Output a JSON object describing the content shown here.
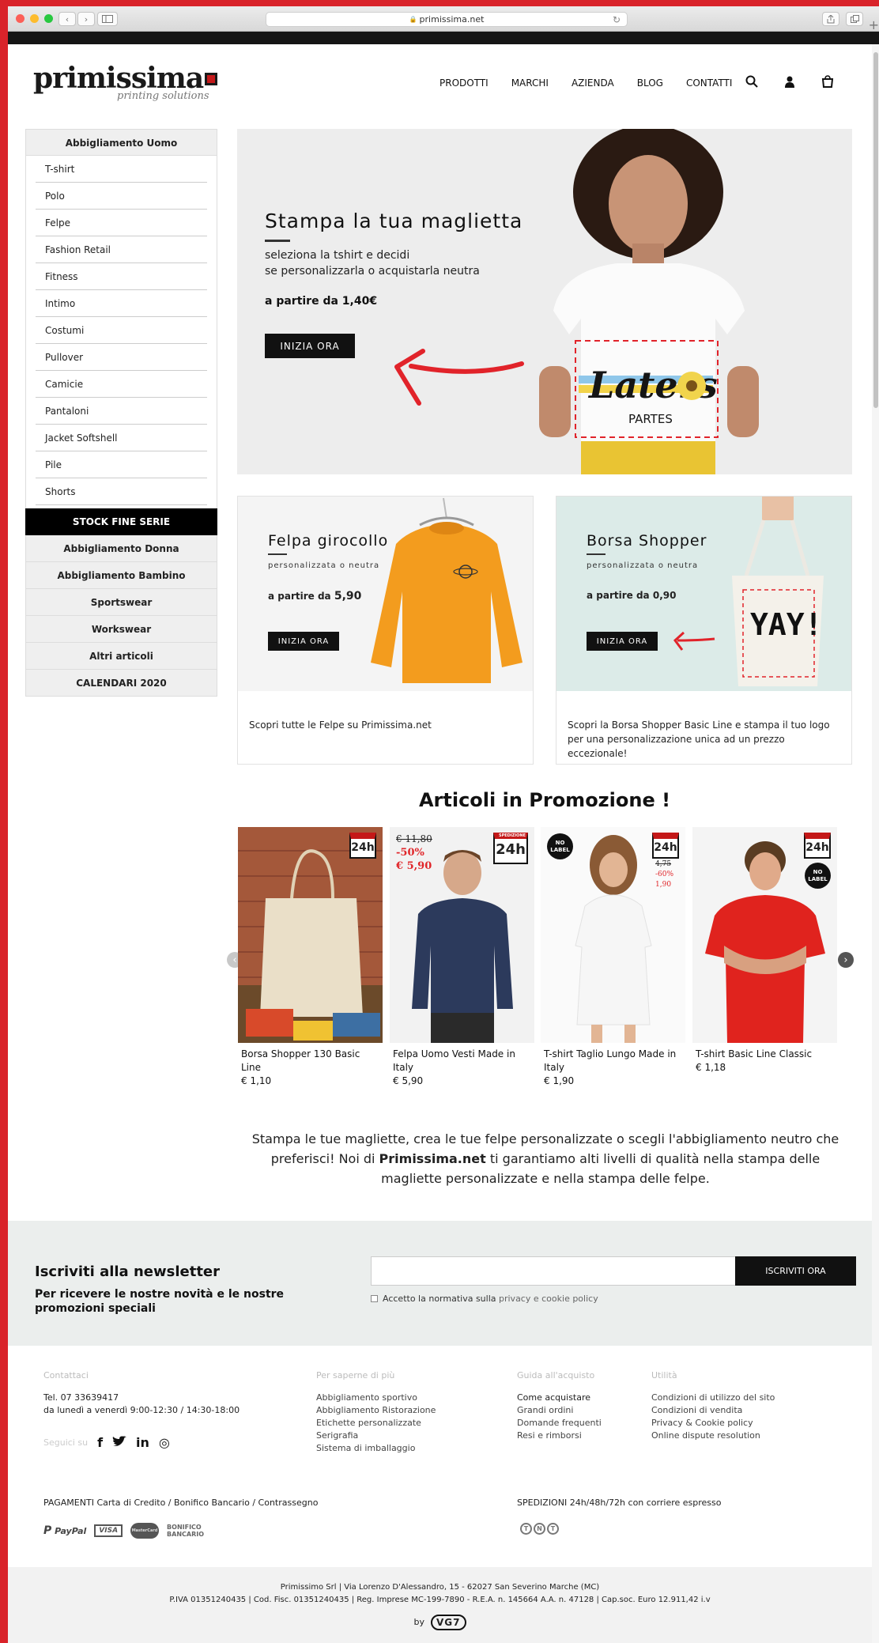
{
  "browser": {
    "url": "primissima.net",
    "lock_icon": "🔒",
    "back_icon": "‹",
    "forward_icon": "›",
    "reload_icon": "↻"
  },
  "header": {
    "logo_text": "primissima",
    "logo_sub": "printing solutions",
    "nav": [
      "PRODOTTI",
      "MARCHI",
      "AZIENDA",
      "BLOG",
      "CONTATTI"
    ]
  },
  "sidebar": {
    "heading": "Abbigliamento Uomo",
    "subitems": [
      "T-shirt",
      "Polo",
      "Felpe",
      "Fashion Retail",
      "Fitness",
      "Intimo",
      "Costumi",
      "Pullover",
      "Camicie",
      "Pantaloni",
      "Jacket Softshell",
      "Pile",
      "Shorts"
    ],
    "stock": "STOCK FINE SERIE",
    "categories": [
      "Abbigliamento Donna",
      "Abbigliamento Bambino",
      "Sportswear",
      "Workswear",
      "Altri articoli",
      "CALENDARI 2020"
    ]
  },
  "hero": {
    "title": "Stampa la tua maglietta",
    "sub1": "seleziona la tshirt e decidi",
    "sub2": "se personalizzarla o acquistarla neutra",
    "price": "a partire da 1,40€",
    "button": "INIZIA ORA",
    "shirt_text": "Laters",
    "shirt_sub": "PARTES"
  },
  "cards": [
    {
      "title": "Felpa girocollo",
      "sub": "personalizzata o neutra",
      "price_prefix": "a partire da ",
      "price": "5,90",
      "button": "INIZIA ORA",
      "desc": "Scopri tutte le Felpe su Primissima.net"
    },
    {
      "title": "Borsa Shopper",
      "sub": "personalizzata o neutra",
      "price_prefix": "a partire da ",
      "price": "0,90",
      "button": "INIZIA ORA",
      "desc": "Scopri la Borsa Shopper Basic Line e stampa il tuo logo per una personalizzazione unica ad un prezzo eccezionale!",
      "bag_text": "YAY!"
    }
  ],
  "promo": {
    "title": "Articoli in Promozione !",
    "badge": "24h",
    "badge_label": "SPEDIZIONE",
    "nolabel": "NO LABEL",
    "products": [
      {
        "name": "Borsa Shopper 130 Basic Line",
        "price": "€ 1,10"
      },
      {
        "name": "Felpa Uomo Vesti Made in Italy",
        "price": "€ 5,90",
        "old": "€ 11,80",
        "pct": "-50%",
        "new": "€ 5,90"
      },
      {
        "name": "T-shirt Taglio Lungo Made in Italy",
        "price": "€ 1,90",
        "old": "4,75",
        "pct": "-60%",
        "new": "1,90"
      },
      {
        "name": "T-shirt Basic Line Classic",
        "price": "€ 1,18"
      }
    ]
  },
  "intro": {
    "part1": "Stampa le tue magliette, crea le tue felpe personalizzate o scegli l'abbigliamento neutro che preferisci! Noi di ",
    "brand": "Primissima.net",
    "part2": " ti garantiamo alti livelli di qualità nella stampa delle magliette personalizzate e nella stampa delle felpe."
  },
  "newsletter": {
    "title": "Iscriviti alla newsletter",
    "subtitle": "Per ricevere le nostre novità e le nostre promozioni speciali",
    "input_value": "",
    "button": "ISCRIVITI ORA",
    "consent": "Accetto la normativa sulla",
    "consent_link": "privacy e cookie policy"
  },
  "footer": {
    "contacts": {
      "heading": "Contattaci",
      "phone": "Tel. 07 33639417",
      "hours": "da lunedì a venerdì 9:00-12:30 / 14:30-18:00",
      "follow": "Seguici su",
      "social": [
        "f",
        "t",
        "in",
        "◎"
      ]
    },
    "more": {
      "heading": "Per saperne di più",
      "links": [
        "Abbigliamento sportivo",
        "Abbigliamento Ristorazione",
        "Etichette personalizzate",
        "Serigrafia",
        "Sistema di imballaggio"
      ]
    },
    "guide": {
      "heading": "Guida all'acquisto",
      "links": [
        "Come acquistare",
        "Grandi ordini",
        "Domande frequenti",
        "Resi e rimborsi"
      ]
    },
    "utility": {
      "heading": "Utilità",
      "links": [
        "Condizioni di utilizzo del sito",
        "Condizioni di vendita",
        "Privacy & Cookie policy",
        "Online dispute resolution"
      ]
    },
    "payments_label": "PAGAMENTI",
    "payments": "Carta di Credito / Bonifico Bancario / Contrassegno",
    "shipping_label": "SPEDIZIONI",
    "shipping": "24h/48h/72h con corriere espresso",
    "pay_logos": [
      "PayPal",
      "VISA",
      "MasterCard",
      "BONIFICO BANCARIO"
    ],
    "tnt": [
      "T",
      "N",
      "T"
    ]
  },
  "legal": {
    "line1": "Primissimo Srl | Via Lorenzo D'Alessandro, 15 - 62027 San Severino Marche (MC)",
    "line2": "P.IVA 01351240435 | Cod. Fisc. 01351240435 | Reg. Imprese MC-199-7890 - R.E.A. n. 145664 A.A. n. 47128 | Cap.soc. Euro 12.911,42 i.v",
    "by": "by",
    "agency": "VG7"
  },
  "colors": {
    "accent_red": "#c51a1b",
    "black": "#111111",
    "newsletter_bg": "#ebeeed"
  }
}
